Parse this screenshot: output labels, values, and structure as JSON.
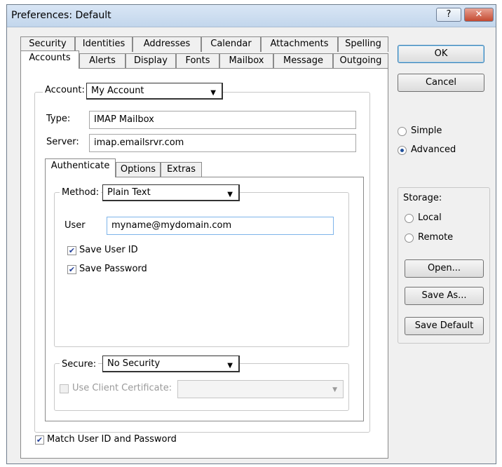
{
  "window": {
    "title": "Preferences: Default",
    "help_label": "?",
    "close_label": "✕"
  },
  "tabs_row1": [
    "Security",
    "Identities",
    "Addresses",
    "Calendar",
    "Attachments",
    "Spelling"
  ],
  "tabs_row2": [
    "Accounts",
    "Alerts",
    "Display",
    "Fonts",
    "Mailbox",
    "Message",
    "Outgoing"
  ],
  "account": {
    "label": "Account:",
    "value": "My Account",
    "type_label": "Type:",
    "type_value": "IMAP Mailbox",
    "server_label": "Server:",
    "server_value": "imap.emailsrvr.com"
  },
  "subtabs": [
    "Authenticate",
    "Options",
    "Extras"
  ],
  "auth": {
    "method_label": "Method:",
    "method_value": "Plain Text",
    "user_label": "User",
    "user_value": "myname@mydomain.com",
    "save_user_label": "Save User ID",
    "save_password_label": "Save Password",
    "secure_label": "Secure:",
    "secure_value": "No Security",
    "client_cert_label": "Use Client Certificate:"
  },
  "match_label": "Match User ID and Password",
  "buttons": {
    "ok": "OK",
    "cancel": "Cancel",
    "open": "Open...",
    "save_as": "Save As...",
    "save_default": "Save Default"
  },
  "mode": {
    "simple": "Simple",
    "advanced": "Advanced"
  },
  "storage": {
    "label": "Storage:",
    "local": "Local",
    "remote": "Remote"
  }
}
